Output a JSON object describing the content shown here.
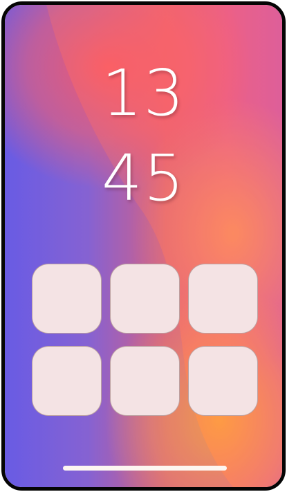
{
  "lock_screen": {
    "time_hours": "13",
    "time_minutes": "45"
  },
  "app_grid": {
    "rows": 2,
    "columns": 3,
    "slots": [
      "",
      "",
      "",
      "",
      "",
      ""
    ]
  },
  "colors": {
    "frame": "#050505",
    "app_slot": "#f4e3e4",
    "clock_text": "#ffffff",
    "home_indicator": "#fdf6f1",
    "wallpaper_purple": "#6a5ce6",
    "wallpaper_coral": "#ff5a64",
    "wallpaper_orange": "#ffa63c",
    "wallpaper_pink": "#e85b92"
  }
}
